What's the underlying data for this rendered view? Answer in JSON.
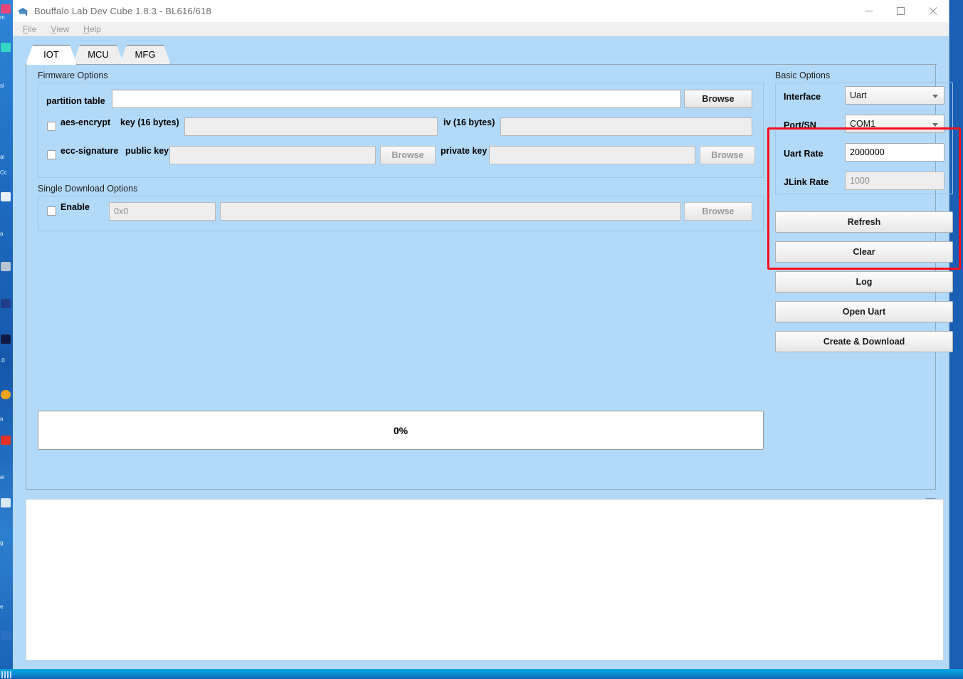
{
  "window": {
    "title": "Bouffalo Lab Dev Cube 1.8.3 - BL616/618",
    "icon": "graduation-cap-icon",
    "controls": {
      "minimize": "minimize-icon",
      "maximize": "maximize-icon",
      "close": "close-icon"
    }
  },
  "menubar": {
    "items": [
      {
        "mnemonic": "F",
        "rest": "ile"
      },
      {
        "mnemonic": "V",
        "rest": "iew"
      },
      {
        "mnemonic": "H",
        "rest": "elp"
      }
    ]
  },
  "tabs": [
    {
      "label": "IOT",
      "active": true
    },
    {
      "label": "MCU",
      "active": false
    },
    {
      "label": "MFG",
      "active": false
    }
  ],
  "firmware_options": {
    "title": "Firmware Options",
    "partition_table": {
      "label": "partition table",
      "value": "",
      "placeholder": "",
      "enabled": true
    },
    "browse_partition": {
      "label": "Browse",
      "enabled": true
    },
    "aes_encrypt": {
      "label": "aes-encrypt",
      "checked": false
    },
    "key_label": "key (16 bytes)",
    "key_value": "",
    "iv_label": "iv (16 bytes)",
    "iv_value": "",
    "ecc_signature": {
      "label": "ecc-signature",
      "checked": false
    },
    "public_key_label": "public key",
    "public_key_value": "",
    "browse_public_key": {
      "label": "Browse",
      "enabled": false
    },
    "private_key_label": "private key",
    "private_key_value": "",
    "browse_private_key": {
      "label": "Browse",
      "enabled": false
    }
  },
  "single_download_options": {
    "title": "Single Download Options",
    "enable": {
      "label": "Enable",
      "checked": false
    },
    "address": {
      "value": "",
      "placeholder": "0x0",
      "enabled": false
    },
    "file": {
      "value": "",
      "enabled": false
    },
    "browse": {
      "label": "Browse",
      "enabled": false
    }
  },
  "basic_options": {
    "title": "Basic Options",
    "highlight_color": "#fc0d1b",
    "rows": [
      {
        "label": "Interface",
        "type": "combo",
        "value": "Uart",
        "enabled": true
      },
      {
        "label": "Port/SN",
        "type": "combo",
        "value": "COM1",
        "enabled": true
      },
      {
        "label": "Uart Rate",
        "type": "input",
        "value": "2000000",
        "enabled": true
      },
      {
        "label": "JLink Rate",
        "type": "input",
        "value": "1000",
        "enabled": false
      }
    ]
  },
  "action_buttons": [
    {
      "label": "Refresh"
    },
    {
      "label": "Clear"
    },
    {
      "label": "Log"
    },
    {
      "label": "Open Uart"
    },
    {
      "label": "Create & Download"
    }
  ],
  "progress": {
    "percent_label": "0%",
    "value": 0
  },
  "splitter": {
    "grip": "·····",
    "float_icon": "restore-window-icon"
  },
  "log": {
    "text": ""
  }
}
